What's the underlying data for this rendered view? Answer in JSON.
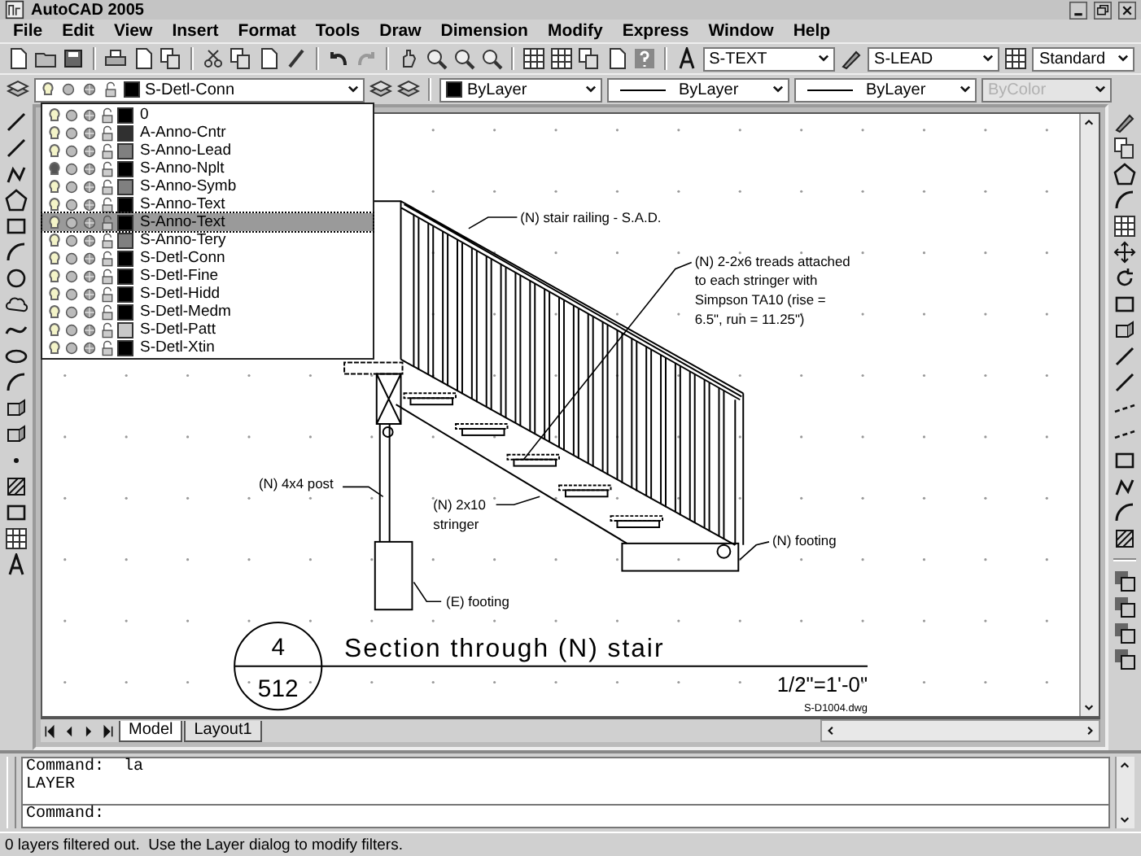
{
  "window": {
    "title": "AutoCAD 2005"
  },
  "menu": [
    "File",
    "Edit",
    "View",
    "Insert",
    "Format",
    "Tools",
    "Draw",
    "Dimension",
    "Modify",
    "Express",
    "Window",
    "Help"
  ],
  "styles_toolbar": {
    "text_style": "S-TEXT",
    "dim_style": "S-LEAD",
    "table_style": "Standard"
  },
  "properties_toolbar": {
    "layer": "S-Detl-Conn",
    "color_setting": "ByLayer",
    "linetype": "ByLayer",
    "lineweight": "ByLayer",
    "plot_style": {
      "value": "ByColor",
      "disabled": true
    }
  },
  "layer_dropdown": {
    "items": [
      {
        "name": "0",
        "on": true,
        "color": "#000000",
        "selected": false
      },
      {
        "name": "A-Anno-Cntr",
        "on": true,
        "color": "#303030",
        "selected": false
      },
      {
        "name": "S-Anno-Lead",
        "on": true,
        "color": "#808080",
        "selected": false
      },
      {
        "name": "S-Anno-Nplt",
        "on": false,
        "color": "#000000",
        "selected": false
      },
      {
        "name": "S-Anno-Symb",
        "on": true,
        "color": "#808080",
        "selected": false
      },
      {
        "name": "S-Anno-Text",
        "on": true,
        "color": "#000000",
        "selected": false
      },
      {
        "name": "S-Anno-Text",
        "on": true,
        "color": "#000000",
        "selected": true
      },
      {
        "name": "S-Anno-Tery",
        "on": true,
        "color": "#808080",
        "selected": false
      },
      {
        "name": "S-Detl-Conn",
        "on": true,
        "color": "#000000",
        "selected": false
      },
      {
        "name": "S-Detl-Fine",
        "on": true,
        "color": "#000000",
        "selected": false
      },
      {
        "name": "S-Detl-Hidd",
        "on": true,
        "color": "#000000",
        "selected": false
      },
      {
        "name": "S-Detl-Medm",
        "on": true,
        "color": "#000000",
        "selected": false
      },
      {
        "name": "S-Detl-Patt",
        "on": true,
        "color": "#c8c8c8",
        "selected": false
      },
      {
        "name": "S-Detl-Xtin",
        "on": true,
        "color": "#000000",
        "selected": false
      }
    ]
  },
  "drawing": {
    "annotations": [
      {
        "lines": [
          "(N) stair railing - S.A.D."
        ]
      },
      {
        "lines": [
          "(N) 2-2x6 treads attached",
          "to each stringer with",
          "Simpson TA10 (rise =",
          "6.5\", run = 11.25\")"
        ]
      },
      {
        "lines": [
          "(N) 4x4 post"
        ]
      },
      {
        "lines": [
          "(N) 2x10",
          "stringer"
        ]
      },
      {
        "lines": [
          "(N) footing"
        ]
      },
      {
        "lines": [
          "(E) footing"
        ]
      }
    ],
    "title_block": {
      "detail_number": "4",
      "sheet_number": "512",
      "title": "Section through (N) stair",
      "scale": "1/2\"=1'-0\"",
      "file": "S-D1004.dwg"
    }
  },
  "layout_tabs": [
    {
      "label": "Model",
      "selected": true
    },
    {
      "label": "Layout1",
      "selected": false
    }
  ],
  "command_window": {
    "lines": [
      "Command:  la",
      "LAYER"
    ],
    "prompt": "Command:"
  },
  "status_bar": "0 layers filtered out.  Use the Layer dialog to modify filters."
}
